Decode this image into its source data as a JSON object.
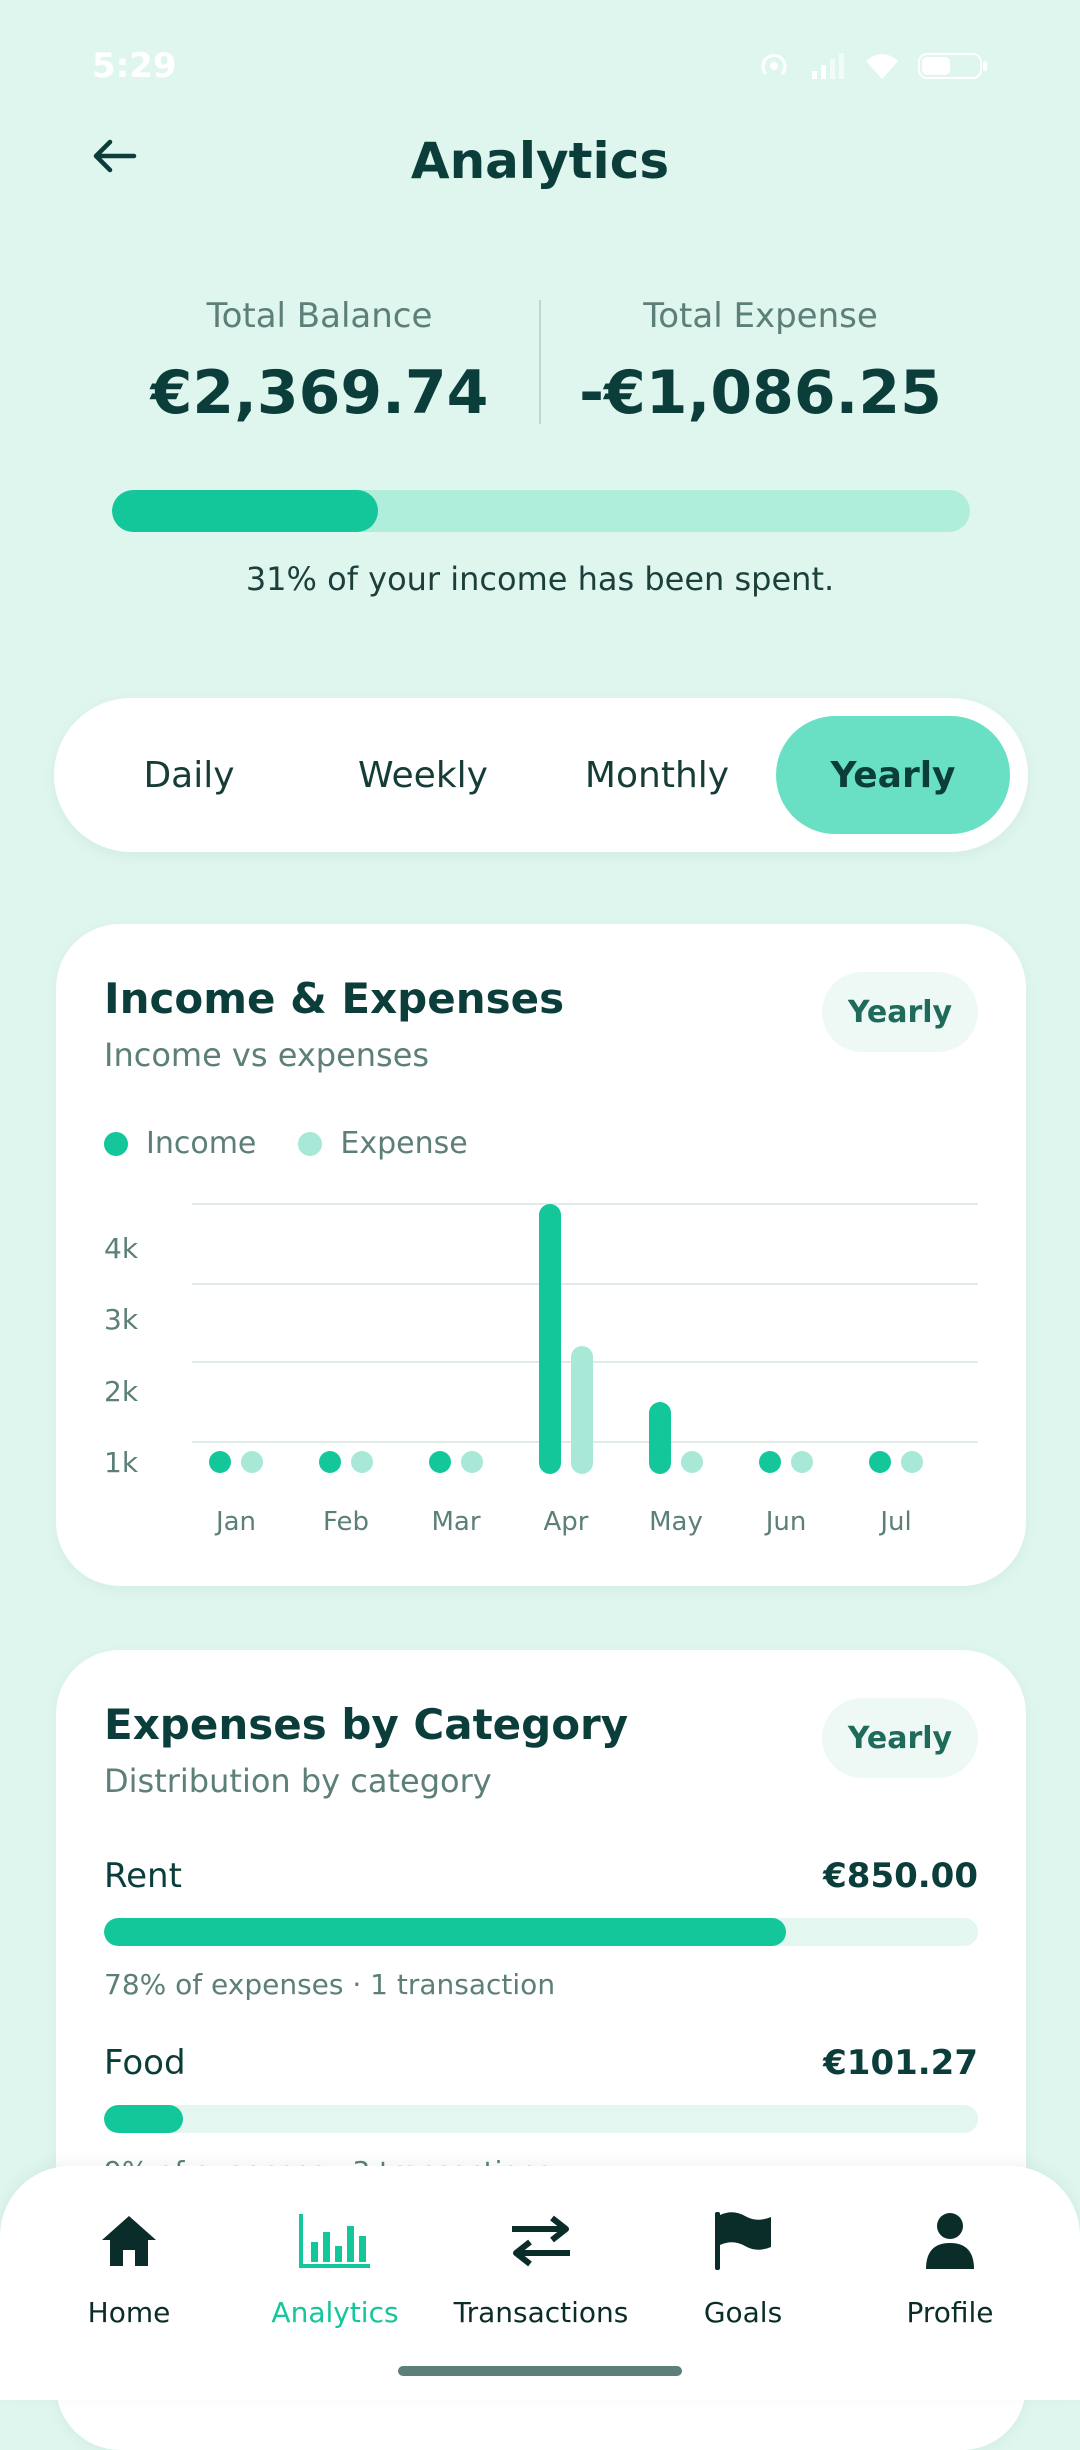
{
  "status": {
    "time": "5:29"
  },
  "header": {
    "title": "Analytics"
  },
  "totals": {
    "balance_label": "Total Balance",
    "balance_value": "€2,369.74",
    "expense_label": "Total Expense",
    "expense_value": "-€1,086.25",
    "spent_fraction": 0.31,
    "spent_text": "31% of your income has been spent."
  },
  "periods": {
    "options": [
      "Daily",
      "Weekly",
      "Monthly",
      "Yearly"
    ],
    "selected": "Yearly"
  },
  "income_card": {
    "title": "Income & Expenses",
    "subtitle": "Income vs expenses",
    "period_badge": "Yearly",
    "legend": {
      "income": "Income",
      "expense": "Expense"
    }
  },
  "chart_data": {
    "type": "bar",
    "title": "Income & Expenses",
    "categories": [
      "Jan",
      "Feb",
      "Mar",
      "Apr",
      "May",
      "Jun",
      "Jul"
    ],
    "series": [
      {
        "name": "Income",
        "values": [
          0,
          0,
          0,
          4500,
          1500,
          0,
          0
        ]
      },
      {
        "name": "Expense",
        "values": [
          0,
          0,
          0,
          2200,
          0,
          0,
          0
        ]
      }
    ],
    "yticks": [
      "1k",
      "2k",
      "3k",
      "4k"
    ],
    "grid": true,
    "legend": "top-left",
    "colors": {
      "income": "#13c79a",
      "expense": "#a7e9d6"
    }
  },
  "category_card": {
    "title": "Expenses by Category",
    "subtitle": "Distribution by category",
    "period_badge": "Yearly",
    "items": [
      {
        "name": "Rent",
        "amount": "€850.00",
        "share": 0.78,
        "meta": "78% of expenses · 1 transaction"
      },
      {
        "name": "Food",
        "amount": "€101.27",
        "share": 0.09,
        "meta": "9% of expenses · 3 transactions"
      }
    ]
  },
  "nav": {
    "items": [
      {
        "label": "Home",
        "icon": "home-icon"
      },
      {
        "label": "Analytics",
        "icon": "bar-chart-icon"
      },
      {
        "label": "Transactions",
        "icon": "swap-icon"
      },
      {
        "label": "Goals",
        "icon": "flag-icon"
      },
      {
        "label": "Profile",
        "icon": "user-icon"
      }
    ],
    "active": "Analytics"
  },
  "theme": {
    "accent": "#13c79a",
    "accent_light": "#69e0c4",
    "background": "#dff6ee",
    "text": "#0b3d3a"
  }
}
